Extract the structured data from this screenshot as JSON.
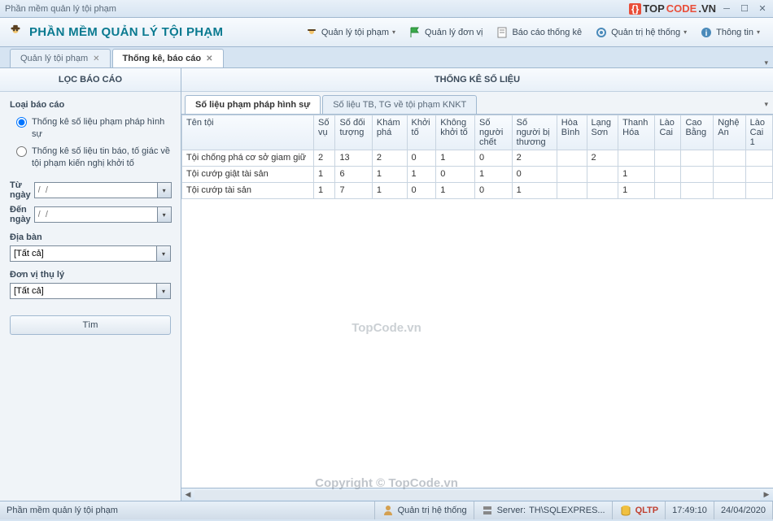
{
  "window": {
    "title": "Phần mềm quản lý tội phạm"
  },
  "brand": {
    "prefix": "{}",
    "name1": "TOP",
    "name2": "CODE",
    "tld": ".VN"
  },
  "toolbar": {
    "app_title": "PHẦN MỀM QUẢN LÝ TỘI PHẠM",
    "menu": {
      "crime": "Quản lý tội phạm",
      "unit": "Quản lý đơn vị",
      "report": "Báo cáo thống kê",
      "admin": "Quản trị hệ thống",
      "info": "Thông tin"
    }
  },
  "tabs": {
    "tab1": "Quản lý tội phạm",
    "tab2": "Thống kê, báo cáo"
  },
  "sidebar": {
    "header": "LỌC BÁO CÁO",
    "group_label": "Loại báo cáo",
    "radio1": "Thống kê số liệu phạm pháp hình sự",
    "radio2": "Thống kê số liệu tin báo, tố giác về tội phạm kiến nghị khởi tố",
    "from_date": "Từ ngày",
    "to_date": "Đến ngày",
    "date_placeholder": "/  /",
    "area_label": "Địa bàn",
    "area_value": "[Tất cả]",
    "unit_label": "Đơn vị thụ lý",
    "unit_value": "[Tất cả]",
    "search": "Tìm"
  },
  "main": {
    "header": "THỐNG KÊ SỐ LIỆU",
    "subtab1": "Số liệu phạm pháp hình sự",
    "subtab2": "Số liệu TB, TG về tội phạm KNKT"
  },
  "grid": {
    "cols": [
      "Tên tội",
      "Số vụ",
      "Số đối tượng",
      "Khám phá",
      "Khởi tố",
      "Không khởi tố",
      "Số người chết",
      "Số người bị thương",
      "Hòa Bình",
      "Lạng Sơn",
      "Thanh Hóa",
      "Lào Cai",
      "Cao Bằng",
      "Nghệ An",
      "Lào Cai 1"
    ],
    "rows": [
      [
        "Tội chống phá cơ sở giam giữ",
        "2",
        "13",
        "2",
        "0",
        "1",
        "0",
        "2",
        "",
        "2",
        "",
        "",
        "",
        "",
        ""
      ],
      [
        "Tội cướp giật tài sản",
        "1",
        "6",
        "1",
        "1",
        "0",
        "1",
        "0",
        "",
        "",
        "1",
        "",
        "",
        "",
        ""
      ],
      [
        "Tội cướp tài sản",
        "1",
        "7",
        "1",
        "0",
        "1",
        "0",
        "1",
        "",
        "",
        "1",
        "",
        "",
        "",
        ""
      ]
    ]
  },
  "status": {
    "app": "Phần mềm quản lý tội phạm",
    "user": "Quản trị hệ thống",
    "server_label": "Server:",
    "server": "TH\\SQLEXPRES...",
    "db": "QLTP",
    "time": "17:49:10",
    "date": "24/04/2020"
  },
  "watermark": "TopCode.vn",
  "copyright": "Copyright © TopCode.vn"
}
